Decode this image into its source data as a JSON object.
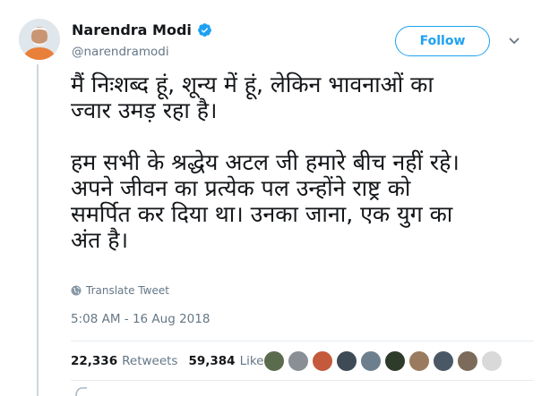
{
  "author": {
    "name": "Narendra Modi",
    "handle": "@narendramodi",
    "verified": true
  },
  "follow_label": "Follow",
  "tweet": {
    "lines_p1": [
      "मैं निःशब्द हूं, शून्य में हूं, लेकिन भावनाओं का",
      "ज्वार उमड़ रहा है।"
    ],
    "lines_p2": [
      "हम सभी के श्रद्धेय अटल जी हमारे बीच नहीं रहे।",
      "अपने जीवन का प्रत्येक पल उन्होंने राष्ट्र को",
      "समर्पित कर दिया था। उनका जाना, एक युग का",
      "अंत है।"
    ]
  },
  "translate_label": "Translate Tweet",
  "timestamp": "5:08 AM - 16 Aug 2018",
  "stats": {
    "retweets_count": "22,336",
    "retweets_label": "Retweets",
    "likes_count": "59,384",
    "likes_label": "Likes"
  },
  "liker_avatars": [
    "#5b6b4e",
    "#8a8f96",
    "#c45a3b",
    "#3e4a55",
    "#6d7f8c",
    "#2f3b2a",
    "#9a7b5f",
    "#4a5866",
    "#7c6b5a",
    "#d9d9d9"
  ],
  "colors": {
    "accent": "#1da1f2",
    "text": "#14171a",
    "muted": "#657786"
  }
}
